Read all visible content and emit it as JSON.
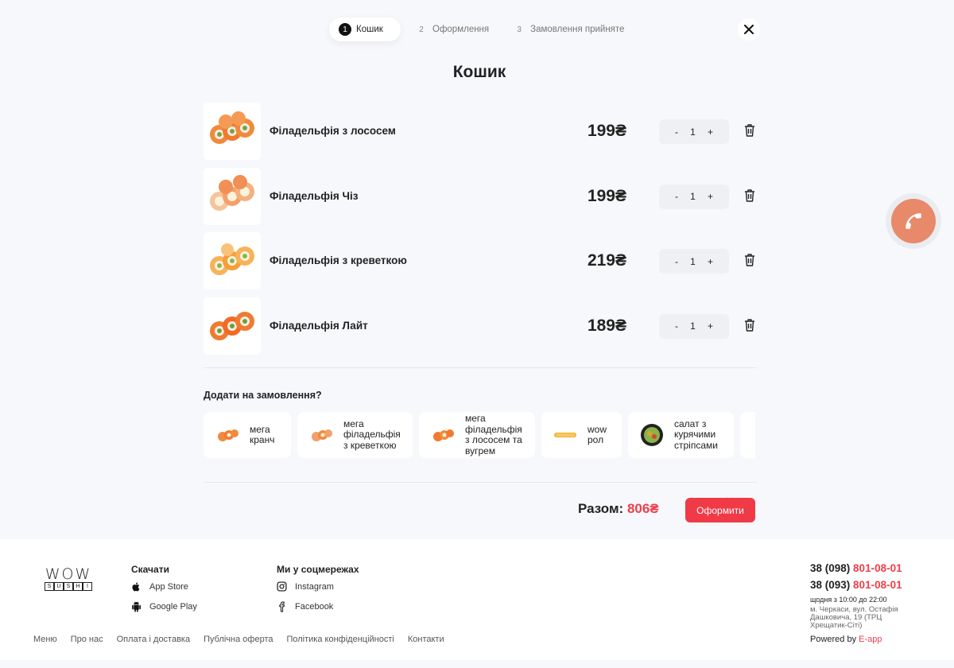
{
  "stepper": {
    "steps": [
      {
        "num": "1",
        "label": "Кошик"
      },
      {
        "num": "2",
        "label": "Оформлення"
      },
      {
        "num": "3",
        "label": "Замовлення прийняте"
      }
    ],
    "close_icon": "close-icon"
  },
  "page_title": "Кошик",
  "cart": {
    "items": [
      {
        "name": "Філадельфія з лососем",
        "price": "199₴",
        "qty": "1"
      },
      {
        "name": "Філадельфія Чіз",
        "price": "199₴",
        "qty": "1"
      },
      {
        "name": "Філадельфія з креветкою",
        "price": "219₴",
        "qty": "1"
      },
      {
        "name": "Філадельфія Лайт",
        "price": "189₴",
        "qty": "1"
      }
    ],
    "minus": "-",
    "plus": "+"
  },
  "addons": {
    "title": "Додати на замовлення?",
    "items": [
      {
        "name": "мега кранч"
      },
      {
        "name": "мега філадельфія з креветкою"
      },
      {
        "name": "мега філадельфія з лососем та вугрем"
      },
      {
        "name": "wow рол"
      },
      {
        "name": "салат з курячими стріпсами"
      }
    ]
  },
  "total": {
    "label": "Разом:",
    "value": "806₴"
  },
  "checkout_label": "Оформити",
  "footer": {
    "logo": {
      "wow": "WOW",
      "sushi": [
        "S",
        "U",
        "S",
        "H",
        "I"
      ]
    },
    "download_title": "Скачати",
    "download": [
      {
        "label": "App Store",
        "icon": "apple-icon"
      },
      {
        "label": "Google Play",
        "icon": "android-icon"
      }
    ],
    "social_title": "Ми у соцмережах",
    "social": [
      {
        "label": "Instagram",
        "icon": "instagram-icon"
      },
      {
        "label": "Facebook",
        "icon": "facebook-icon"
      }
    ],
    "links": [
      "Меню",
      "Про нас",
      "Оплата і доставка",
      "Публічна оферта",
      "Політика конфіденційності",
      "Контакти"
    ],
    "phones": [
      {
        "prefix": "38 (098) ",
        "number": "801-08-01"
      },
      {
        "prefix": "38 (093) ",
        "number": "801-08-01"
      }
    ],
    "hours": "щодня з 10:00 до 22:00",
    "address": "м. Черкаси, вул. Остафія Дашковича, 19 (ТРЦ Хрещатик-Сіті)",
    "powered_label": "Powered by ",
    "powered_brand": "E-app"
  },
  "colors": {
    "accent": "#ef3e4a",
    "call_button": "#e8896a",
    "background": "#f7f8fb"
  }
}
